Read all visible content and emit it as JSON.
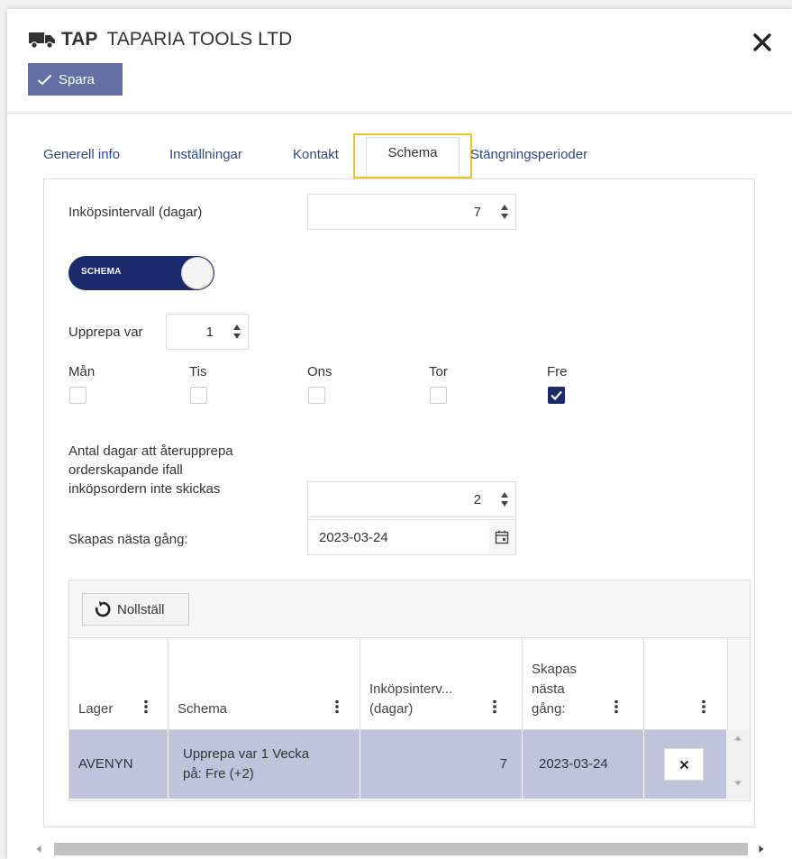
{
  "header": {
    "code": "TAP",
    "name": "TAPARIA TOOLS LTD",
    "save_label": "Spara"
  },
  "tabs": [
    {
      "label": "Generell info"
    },
    {
      "label": "Inställningar"
    },
    {
      "label": "Kontakt"
    },
    {
      "label": "Schema"
    },
    {
      "label": "Stängningsperioder"
    }
  ],
  "active_tab": "Schema",
  "form": {
    "interval_label": "Inköpsintervall (dagar)",
    "interval_value": "7",
    "toggle_label": "SCHEMA",
    "repeat_label": "Upprepa var",
    "repeat_value": "1",
    "days": [
      {
        "label": "Mån",
        "checked": false
      },
      {
        "label": "Tis",
        "checked": false
      },
      {
        "label": "Ons",
        "checked": false
      },
      {
        "label": "Tor",
        "checked": false
      },
      {
        "label": "Fre",
        "checked": true
      }
    ],
    "retry_label_1": "Antal dagar att återupprepa",
    "retry_label_2": "orderskapande ifall",
    "retry_label_3": "inköpsordern inte skickas",
    "retry_value": "2",
    "next_label": "Skapas nästa gång:",
    "next_value": "2023-03-24"
  },
  "grid": {
    "reset_label": "Nollställ",
    "columns": [
      {
        "lines": [
          "Lager"
        ]
      },
      {
        "lines": [
          "Schema"
        ]
      },
      {
        "lines": [
          "Inköpsinterv...",
          "(dagar)"
        ]
      },
      {
        "lines": [
          "Skapas",
          "nästa",
          "gång:"
        ]
      },
      {
        "lines": [
          ""
        ]
      }
    ],
    "rows": [
      {
        "lager": "AVENYN",
        "schema_1": "Upprepa var 1 Vecka",
        "schema_2": "på: Fre (+2)",
        "interval": "7",
        "next": "2023-03-24"
      }
    ]
  },
  "colors": {
    "accent": "#1b2a6b",
    "save_button": "#6270a6",
    "row_selected": "#bfc4dc",
    "tab_highlight": "#f2c12e",
    "link": "#2b4a8c"
  }
}
